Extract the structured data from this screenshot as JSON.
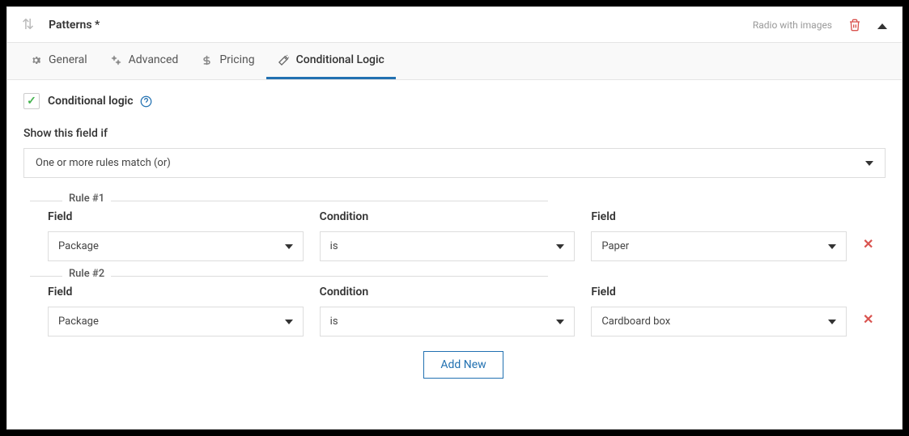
{
  "header": {
    "title": "Patterns *",
    "field_type": "Radio with images"
  },
  "tabs": {
    "general": "General",
    "advanced": "Advanced",
    "pricing": "Pricing",
    "conditional": "Conditional Logic"
  },
  "content": {
    "checkbox_label": "Conditional logic",
    "show_label": "Show this field if",
    "match_select": "One or more rules match (or)",
    "col_field": "Field",
    "col_condition": "Condition",
    "add_new": "Add New"
  },
  "rules": [
    {
      "legend": "Rule #1",
      "field": "Package",
      "condition": "is",
      "value": "Paper"
    },
    {
      "legend": "Rule #2",
      "field": "Package",
      "condition": "is",
      "value": "Cardboard box"
    }
  ]
}
